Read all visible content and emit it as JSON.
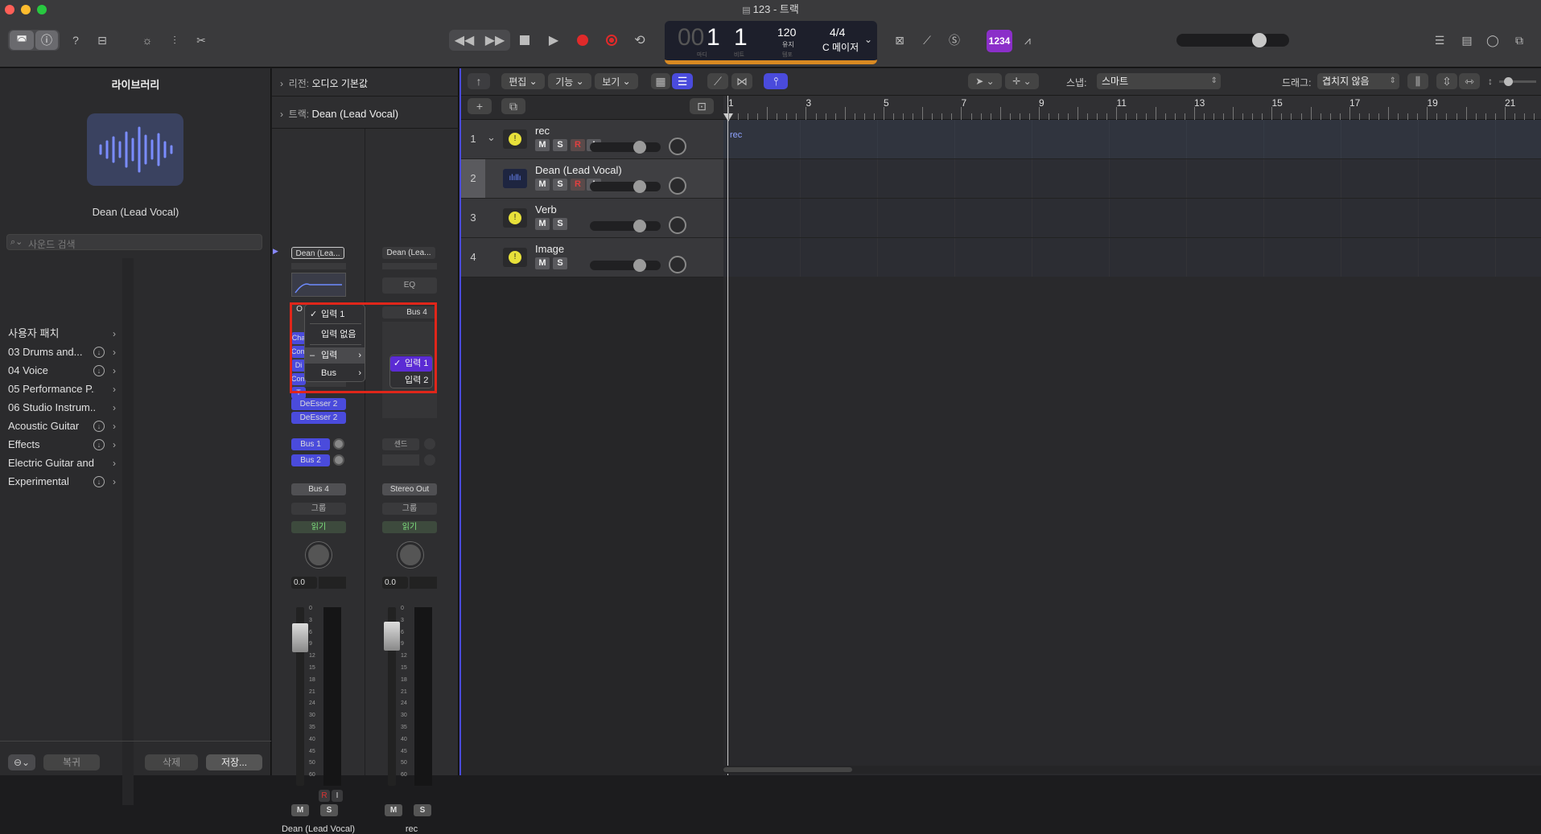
{
  "window": {
    "title": "123 - 트랙"
  },
  "transport": {
    "bars_dim": "00",
    "bar": "1",
    "beat": "1",
    "bar_label": "마디",
    "beat_label": "비트",
    "tempo": "120",
    "tempo_sub": "유지",
    "tempo_label": "템포",
    "time_sig": "4/4",
    "key": "C 메이저",
    "count_in": "1234"
  },
  "library": {
    "title": "라이브러리",
    "patch_name": "Dean (Lead Vocal)",
    "search_placeholder": "사운드 검색",
    "items": [
      {
        "label": "사용자 패치",
        "dl": false
      },
      {
        "label": "03 Drums and...",
        "dl": true
      },
      {
        "label": "04 Voice",
        "dl": true
      },
      {
        "label": "05 Performance P...",
        "dl": false
      },
      {
        "label": "06 Studio Instrum...",
        "dl": false
      },
      {
        "label": "Acoustic Guitar",
        "dl": true
      },
      {
        "label": "Effects",
        "dl": true
      },
      {
        "label": "Electric Guitar and...",
        "dl": false
      },
      {
        "label": "Experimental",
        "dl": true
      }
    ],
    "revert": "복귀",
    "delete": "삭제",
    "save": "저장..."
  },
  "inspector": {
    "region_label": "리전:",
    "region_value": "오디오 기본값",
    "track_label": "트랙:",
    "track_value": "Dean (Lead Vocal)",
    "strip1": {
      "setting": "Dean (Lea...",
      "plugins": [
        "Cha",
        "Com",
        "Di",
        "Com",
        "T",
        "DeEsser 2",
        "DeEsser 2"
      ],
      "sends": [
        "Bus 1",
        "Bus 2"
      ],
      "output": "Bus 4",
      "group": "그룹",
      "auto": "읽기",
      "pan_val": "0.0",
      "m": "M",
      "s": "S",
      "r": "R",
      "i": "I",
      "name": "Dean (Lead Vocal)"
    },
    "strip2": {
      "setting": "Dean (Lea...",
      "eq": "EQ",
      "input": "Bus 4",
      "sends_label": "센드",
      "output": "Stereo Out",
      "group": "그룹",
      "auto": "읽기",
      "pan_val": "0.0",
      "m": "M",
      "s": "S",
      "name": "rec"
    },
    "meter_ticks": [
      "0",
      "3",
      "6",
      "9",
      "12",
      "15",
      "18",
      "21",
      "24",
      "30",
      "35",
      "40",
      "45",
      "50",
      "60"
    ]
  },
  "menu": {
    "item1": "입력 1",
    "item2": "입력 없음",
    "item3": "입력",
    "item4": "Bus",
    "sub1": "입력 1",
    "sub2": "입력 2",
    "check": "✓",
    "dash": "–"
  },
  "tracks_toolbar": {
    "edit": "편집",
    "func": "기능",
    "view": "보기",
    "snap_label": "스냅:",
    "snap_value": "스마트",
    "drag_label": "드래그:",
    "drag_value": "겹치지 않음"
  },
  "ruler": [
    "1",
    "3",
    "5",
    "7",
    "9",
    "11",
    "13",
    "15",
    "17",
    "19",
    "21"
  ],
  "tracks": [
    {
      "num": "1",
      "name": "rec",
      "m": "M",
      "s": "S",
      "r": "R",
      "i": "I"
    },
    {
      "num": "2",
      "name": "Dean (Lead Vocal)",
      "m": "M",
      "s": "S",
      "r": "R",
      "i": "I"
    },
    {
      "num": "3",
      "name": "Verb",
      "m": "M",
      "s": "S"
    },
    {
      "num": "4",
      "name": "Image",
      "m": "M",
      "s": "S"
    }
  ],
  "region_label": "rec"
}
